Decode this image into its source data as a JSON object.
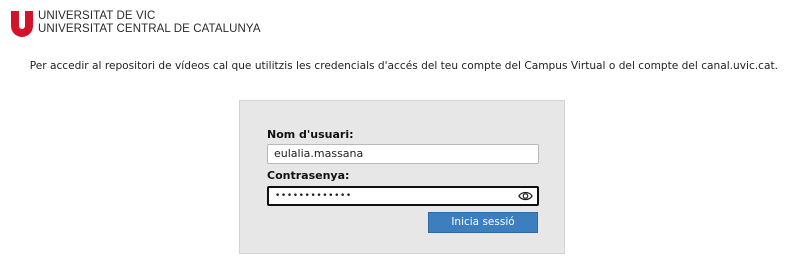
{
  "branding": {
    "line1": "UNIVERSITAT DE VIC",
    "line2": "UNIVERSITAT CENTRAL DE CATALUNYA",
    "brand_color": "#d3132a"
  },
  "intro_text": "Per accedir al repositori de vídeos cal que utilitzis les credencials d'accés del teu compte del Campus Virtual o del compte del canal.uvic.cat.",
  "login": {
    "username_label": "Nom d'usuari:",
    "username_value": "eulalia.massana",
    "password_label": "Contrasenya:",
    "password_mask": "•••••••••••••",
    "submit_label": "Inicia sessió",
    "button_color": "#3d7ebe"
  },
  "icons": {
    "logo": "uvic-u-logo-icon",
    "show_password": "eye-icon"
  }
}
